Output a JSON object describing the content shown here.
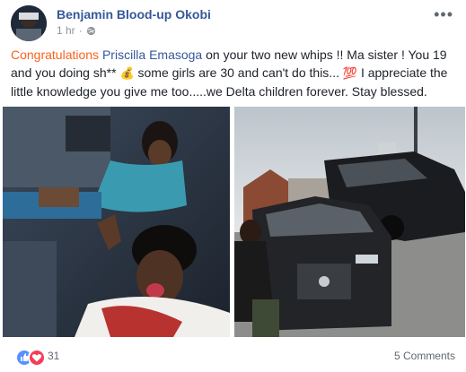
{
  "post": {
    "author": "Benjamin Blood-up Okobi",
    "time": "1 hr",
    "more_label": "•••",
    "text_parts": {
      "tag": "Congratulations",
      "mention": "Priscilla Emasoga",
      "part1": " on your two new whips !! Ma sister ! You 19 and you doing sh** ",
      "emoji_money": "💰",
      "part2": " some girls are 30 and can't do this... ",
      "emoji_100": "💯",
      "part3": " I appreciate the little knowledge you give me too.....we Delta children forever. Stay blessed."
    }
  },
  "footer": {
    "reaction_count": "31",
    "comments_label": "5 Comments"
  },
  "icons": {
    "globe": "globe-icon",
    "like": "like-icon",
    "love": "love-icon",
    "more": "more-icon"
  },
  "colors": {
    "link": "#365899",
    "tag": "#f7631b",
    "meta": "#90949c"
  }
}
